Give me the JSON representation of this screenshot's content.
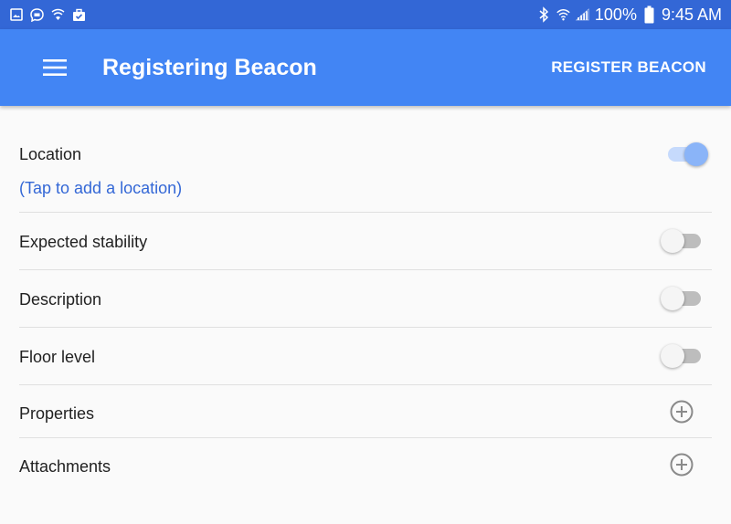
{
  "status_bar": {
    "battery_percent": "100%",
    "time": "9:45 AM",
    "icons": [
      "image-icon",
      "chat-icon",
      "shield-wifi-icon",
      "briefcase-check-icon",
      "bluetooth-icon",
      "wifi-icon",
      "signal-icon",
      "battery-icon"
    ]
  },
  "app_bar": {
    "title": "Registering Beacon",
    "action_label": "REGISTER BEACON",
    "color": "#4285f4"
  },
  "rows": [
    {
      "label": "Location",
      "sublabel": "(Tap to add a location)",
      "control": "toggle",
      "on": true
    },
    {
      "label": "Expected stability",
      "control": "toggle",
      "on": false
    },
    {
      "label": "Description",
      "control": "toggle",
      "on": false
    },
    {
      "label": "Floor level",
      "control": "toggle",
      "on": false
    },
    {
      "label": "Properties",
      "control": "add"
    },
    {
      "label": "Attachments",
      "control": "add"
    }
  ]
}
